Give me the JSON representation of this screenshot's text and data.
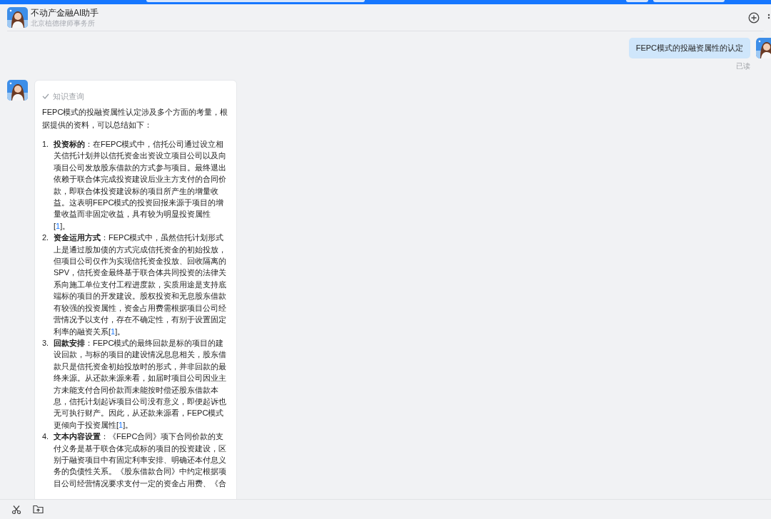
{
  "header": {
    "title": "不动产金融AI助手",
    "subtitle": "北京植德律师事务所"
  },
  "user_message": {
    "text": "FEPC模式的投融资属性的认定",
    "status": "已读"
  },
  "assistant_message": {
    "tool_step": {
      "label": "知识查询",
      "done": true
    },
    "intro": "FEPC模式的投融资属性认定涉及多个方面的考量，根据提供的资料，可以总结如下：",
    "items": [
      {
        "number": "1.",
        "heading": "投资标的",
        "segments": [
          {
            "kind": "plain",
            "text": "：在FEPC模式中，信托公司通过设立相关信托计划并以信托资金出资设立项目公司以及向项目公司发放股东借款的方式参与项目。最终退出依赖于联合体完成投资建设后业主方支付的合同价款，即联合体投资建设标的项目所产生的增量收益。这表明FEPC模式的投资回报来源于项目的增量收益而非固定收益，具有较为明显投资属性 ["
          },
          {
            "kind": "citation",
            "text": "1"
          },
          {
            "kind": "plain",
            "text": "]。"
          }
        ]
      },
      {
        "number": "2.",
        "heading": "资金运用方式",
        "segments": [
          {
            "kind": "plain",
            "text": "：FEPC模式中，虽然信托计划形式上是通过股加债的方式完成信托资金的初始投放，但项目公司仅作为实现信托资金投放、回收隔离的SPV，信托资金最终基于联合体共同投资的法律关系向施工单位支付工程进度款，实质用途是支持底端标的项目的开发建设。股权投资和无息股东借款有较强的投资属性，资金占用费需根据项目公司经营情况予以支付，存在不确定性，有别于设置固定利率的融资关系["
          },
          {
            "kind": "citation",
            "text": "1"
          },
          {
            "kind": "plain",
            "text": "]。"
          }
        ]
      },
      {
        "number": "3.",
        "heading": "回款安排",
        "segments": [
          {
            "kind": "plain",
            "text": "：FEPC模式的最终回款是标的项目的建设回款，与标的项目的建设情况息息相关，股东借款只是信托资金初始投放时的形式，并非回款的最终来源。从还款来源来看，如届时项目公司因业主方未能支付合同价款而未能按时偿还股东借款本息，信托计划起诉项目公司没有意义，即便起诉也无可执行财产。因此，从还款来源看，FEPC模式更倾向于投资属性["
          },
          {
            "kind": "citation",
            "text": "1"
          },
          {
            "kind": "plain",
            "text": "]。"
          }
        ]
      },
      {
        "number": "4.",
        "heading": "文本内容设置",
        "segments": [
          {
            "kind": "plain",
            "text": "：《FEPC合同》项下合同价款的支付义务是基于联合体完成标的项目的投资建设，区别于融资项目中有固定利率安排、明确还本付息义务的负债性关系。《股东借款合同》中约定根据项目公司经营情况要求支付一定的资金占用费、《合"
          }
        ]
      }
    ]
  }
}
